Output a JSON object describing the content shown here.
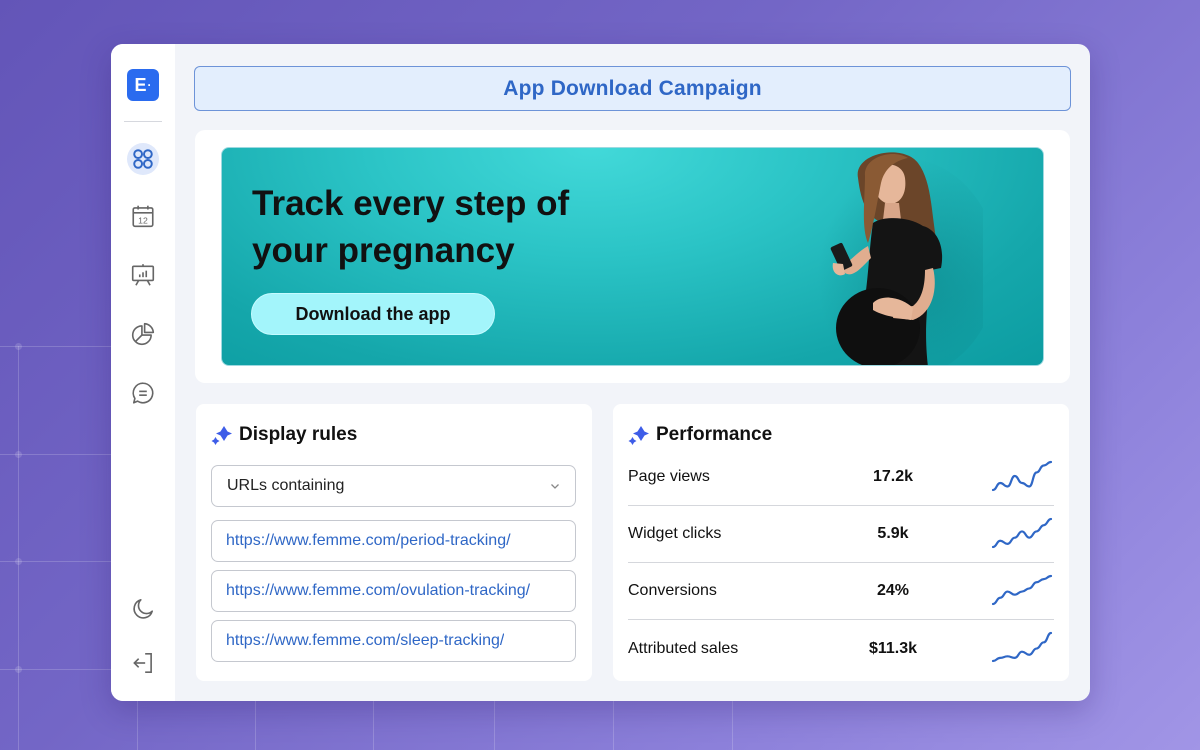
{
  "app": {
    "logo_letter": "E",
    "logo_dot": "·",
    "brand_color": "#2a6bef",
    "accent_color": "#2f67c6"
  },
  "sidebar": {
    "items": [
      {
        "name": "dashboard",
        "icon": "grid-circles-icon",
        "active": true
      },
      {
        "name": "calendar",
        "icon": "calendar-icon",
        "label": "12",
        "active": false
      },
      {
        "name": "presentation",
        "icon": "presentation-chart-icon",
        "active": false
      },
      {
        "name": "analytics",
        "icon": "pie-chart-icon",
        "active": false
      },
      {
        "name": "messages",
        "icon": "chat-bubble-icon",
        "active": false
      }
    ],
    "bottom_items": [
      {
        "name": "dark-mode",
        "icon": "moon-icon"
      },
      {
        "name": "logout",
        "icon": "logout-icon"
      }
    ]
  },
  "header": {
    "title": "App Download Campaign"
  },
  "banner": {
    "headline_line1": "Track every step of",
    "headline_line2": "your pregnancy",
    "cta_label": "Download the app",
    "image_description": "pregnant woman smiling at phone"
  },
  "display_rules": {
    "title": "Display rules",
    "condition_select": "URLs containing",
    "urls": [
      "https://www.femme.com/period-tracking/",
      "https://www.femme.com/ovulation-tracking/",
      "https://www.femme.com/sleep-tracking/"
    ]
  },
  "performance": {
    "title": "Performance",
    "metrics": [
      {
        "label": "Page views",
        "value": "17.2k",
        "trend": [
          2,
          4,
          3,
          6,
          4,
          3,
          7,
          9,
          10
        ]
      },
      {
        "label": "Widget clicks",
        "value": "5.9k",
        "trend": [
          1,
          3,
          2,
          4,
          6,
          4,
          6,
          8,
          10
        ]
      },
      {
        "label": "Conversions",
        "value": "24%",
        "trend": [
          1,
          3,
          5,
          4,
          5,
          6,
          8,
          9,
          10
        ]
      },
      {
        "label": "Attributed sales",
        "value": "$11.3k",
        "trend": [
          1,
          2,
          2.5,
          2,
          4,
          3,
          5,
          7,
          10
        ]
      }
    ]
  }
}
